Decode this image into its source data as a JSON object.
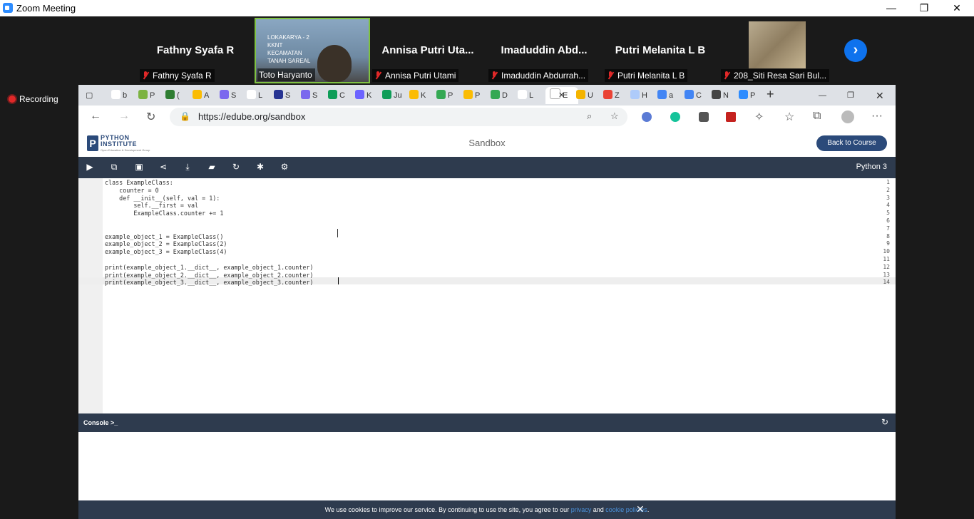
{
  "zoom": {
    "title": "Zoom Meeting",
    "window_buttons": [
      "—",
      "❐",
      "✕"
    ],
    "recording_label": "Recording"
  },
  "participants": [
    {
      "name": "Fathny Syafa R",
      "label": "Fathny Syafa R",
      "muted": true
    },
    {
      "name": "",
      "label": "Toto Haryanto",
      "muted": false,
      "video": true,
      "video_lines": [
        "LOKAKARYA - 2",
        "KKNT",
        "KECAMATAN",
        "TANAH SAREAL"
      ]
    },
    {
      "name": "Annisa Putri Uta...",
      "label": "Annisa Putri Utami",
      "muted": true
    },
    {
      "name": "Imaduddin  Abd...",
      "label": "Imaduddin Abdurrah...",
      "muted": true
    },
    {
      "name": "Putri Melanita L B",
      "label": "Putri Melanita L B",
      "muted": true
    },
    {
      "name": "",
      "label": "208_Siti Resa Sari Bul...",
      "muted": true,
      "photo": true
    }
  ],
  "browser": {
    "url": "https://edube.org/sandbox",
    "tabs": [
      {
        "letter": "b",
        "color": "#ffffff"
      },
      {
        "letter": "P",
        "color": "#7cb342"
      },
      {
        "letter": "(",
        "color": "#2e7d32"
      },
      {
        "letter": "A",
        "color": "#fbbc04"
      },
      {
        "letter": "S",
        "color": "#7b68ee"
      },
      {
        "letter": "L",
        "color": "#ffffff"
      },
      {
        "letter": "S",
        "color": "#283593"
      },
      {
        "letter": "S",
        "color": "#7b68ee"
      },
      {
        "letter": "C",
        "color": "#0f9d58"
      },
      {
        "letter": "K",
        "color": "#6c63ff"
      },
      {
        "letter": "Ju",
        "color": "#0f9d58"
      },
      {
        "letter": "K",
        "color": "#fbbc04"
      },
      {
        "letter": "P",
        "color": "#34a853"
      },
      {
        "letter": "P",
        "color": "#fbbc04"
      },
      {
        "letter": "D",
        "color": "#34a853"
      },
      {
        "letter": "L",
        "color": "#ffffff"
      }
    ],
    "active_tab_letter": "E",
    "more_tabs": [
      "U",
      "Z",
      "H",
      "a",
      "C",
      "N",
      "P"
    ]
  },
  "page": {
    "logo_title": "PYTHON",
    "logo_title2": "INSTITUTE",
    "logo_sub": "Open Education & Development Group",
    "title": "Sandbox",
    "back_button": "Back to Course",
    "language": "Python 3"
  },
  "code_lines": [
    "class ExampleClass:",
    "    counter = 0",
    "    def __init__(self, val = 1):",
    "        self.__first = val",
    "        ExampleClass.counter += 1",
    "",
    "",
    "example_object_1 = ExampleClass()",
    "example_object_2 = ExampleClass(2)",
    "example_object_3 = ExampleClass(4)",
    "",
    "print(example_object_1.__dict__, example_object_1.counter)",
    "print(example_object_2.__dict__, example_object_2.counter)",
    "print(example_object_3.__dict__, example_object_3.counter)"
  ],
  "console": {
    "label": "Console >_"
  },
  "cookie": {
    "text": "We use cookies to improve our service. By continuing to use the site, you agree to our",
    "privacy": "privacy",
    "and": "and",
    "cookie_policies": "cookie policies",
    "end": "."
  }
}
